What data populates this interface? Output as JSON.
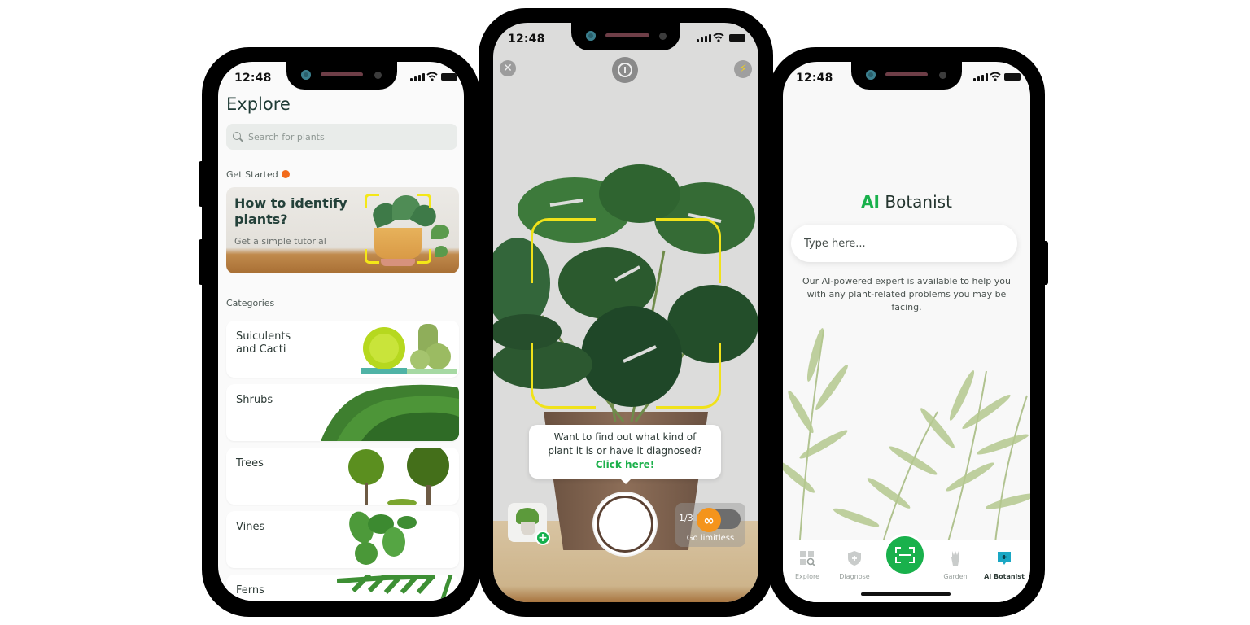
{
  "status_bar": {
    "time": "12:48"
  },
  "explore": {
    "title": "Explore",
    "search": {
      "placeholder": "Search for plants",
      "value": ""
    },
    "get_started_label": "Get Started",
    "tutorial": {
      "title": "How to identify plants?",
      "subtitle": "Get a simple tutorial"
    },
    "categories_label": "Categories",
    "categories": [
      {
        "label": "Suiculents\nand Cacti"
      },
      {
        "label": "Shrubs"
      },
      {
        "label": "Trees"
      },
      {
        "label": "Vines"
      },
      {
        "label": "Ferns"
      }
    ]
  },
  "camera": {
    "close_icon": "close-icon",
    "info_icon": "info-icon",
    "flash_icon": "flash-icon",
    "tooltip": {
      "line1": "Want to find out what kind of",
      "line2": "plant it is or have it diagnosed?",
      "cta": "Click here!"
    },
    "scan_count": "1/3",
    "limit_icon": "∞",
    "limit_label": "Go limitless"
  },
  "botanist": {
    "title_accent": "AI",
    "title_rest": " Botanist",
    "input": {
      "placeholder": "Type here...",
      "value": ""
    },
    "description": "Our AI-powered expert is available to help you with any plant-related problems you may be facing.",
    "tabs": [
      {
        "label": "Explore",
        "active": false
      },
      {
        "label": "Diagnose",
        "active": false
      },
      {
        "label": "Garden",
        "active": false
      },
      {
        "label": "AI Botanist",
        "active": true
      }
    ]
  },
  "colors": {
    "brand_green": "#19b14c",
    "scan_yellow": "#f0e21a",
    "notification_orange": "#f26a1b",
    "limit_orange": "#f4941c"
  }
}
